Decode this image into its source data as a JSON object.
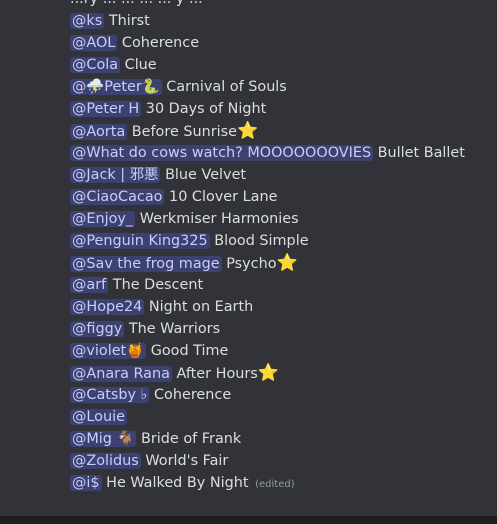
{
  "top_partial_text": "...ry ... ... ... ... y ...",
  "lines": [
    {
      "mention": "@ks",
      "text": "Thirst"
    },
    {
      "mention": "@AOL",
      "text": "Coherence"
    },
    {
      "mention": "@Cola",
      "text": "Clue"
    },
    {
      "mention": "@⛈️Peter🐍",
      "text": "Carnival of Souls"
    },
    {
      "mention": "@Peter H",
      "text": "30 Days of Night"
    },
    {
      "mention": "@Aorta",
      "text": "Before Sunrise",
      "star": true
    },
    {
      "mention": "@What do cows watch? MOOOOOOOVIES",
      "text": "Bullet Ballet"
    },
    {
      "mention": "@Jack | 邪悪",
      "text": "Blue Velvet"
    },
    {
      "mention": "@CiaoCacao",
      "text": "10 Clover Lane"
    },
    {
      "mention": "@Enjoy_",
      "text": "Werkmiser Harmonies"
    },
    {
      "mention": "@Penguin King325",
      "text": "Blood Simple"
    },
    {
      "mention": "@Sav the frog mage",
      "text": "Psycho",
      "star": true
    },
    {
      "mention": "@arf",
      "text": "The Descent"
    },
    {
      "mention": "@Hope24",
      "text": "Night on Earth"
    },
    {
      "mention": "@figgy",
      "text": "The Warriors"
    },
    {
      "mention": "@violet🍯",
      "text": "Good Time"
    },
    {
      "mention": "@Anara Rana",
      "text": "After Hours",
      "star": true
    },
    {
      "mention": "@Catsby ♭",
      "text": "Coherence"
    },
    {
      "mention": "@Louie",
      "text": ""
    },
    {
      "mention": "@Mig 🐐",
      "text": "Bride of Frank"
    },
    {
      "mention": "@Zolidus",
      "text": "World's Fair"
    },
    {
      "mention": "@i$",
      "text": "He Walked By Night",
      "edited": "(edited)"
    }
  ],
  "star_glyph": "⭐",
  "colors": {
    "background": "#313338",
    "mention_bg": "rgba(88,101,242,0.30)",
    "mention_text": "#c9cdfb",
    "text": "#dbdee1",
    "muted": "#949ba4",
    "star": "#f5b324"
  }
}
